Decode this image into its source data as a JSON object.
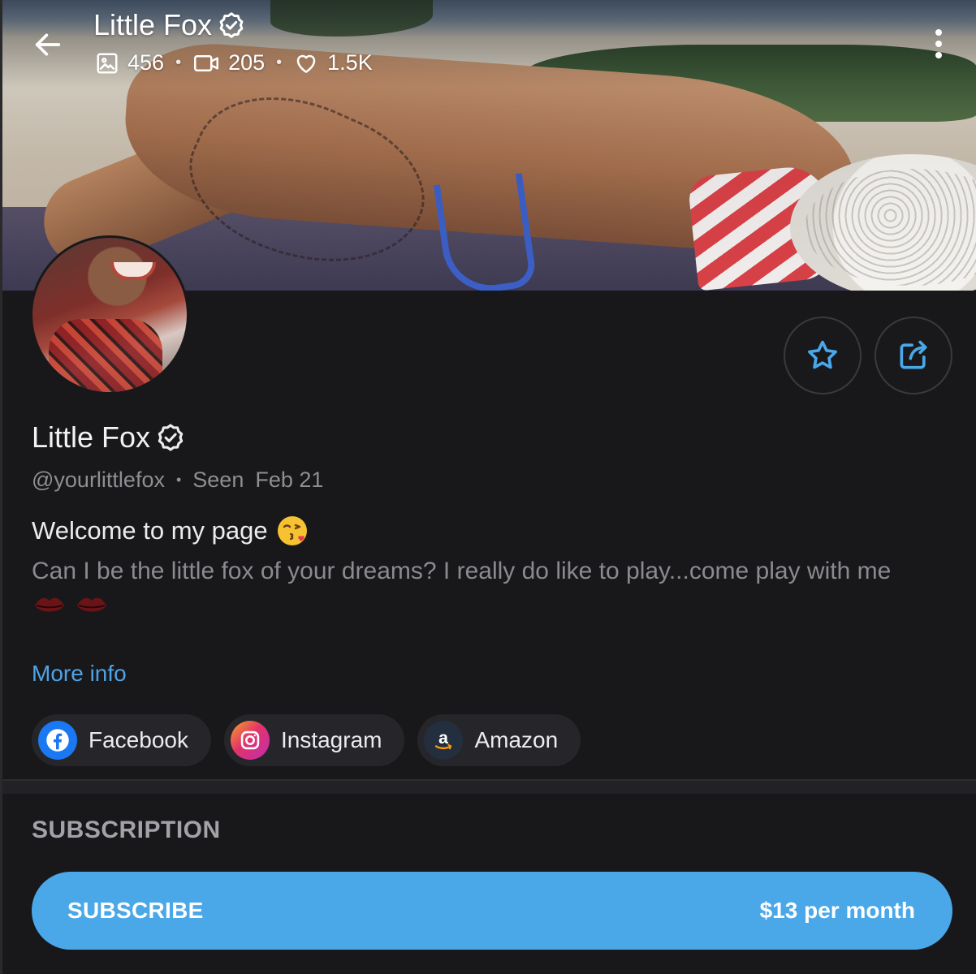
{
  "header": {
    "title": "Little Fox",
    "stats": [
      {
        "icon": "image-icon",
        "value": "456"
      },
      {
        "icon": "video-icon",
        "value": "205"
      },
      {
        "icon": "heart-icon",
        "value": "1.5K"
      }
    ]
  },
  "profile": {
    "name": "Little Fox",
    "handle": "@yourlittlefox",
    "seen_label": "Seen",
    "seen_date": "Feb 21",
    "bio_line1": "Welcome to my page",
    "bio_line1_emoji": "kiss-face-emoji",
    "bio_line2": "Can I be the little fox of your dreams? I really do like to play...come play with me",
    "bio_emojis": [
      "lips-emoji",
      "lips-emoji"
    ],
    "more_info": "More info"
  },
  "social_links": [
    {
      "label": "Facebook",
      "icon": "facebook-icon"
    },
    {
      "label": "Instagram",
      "icon": "instagram-icon"
    },
    {
      "label": "Amazon",
      "icon": "amazon-icon"
    }
  ],
  "subscription": {
    "section_title": "SUBSCRIPTION",
    "button_label": "SUBSCRIBE",
    "price": "$13 per month"
  },
  "colors": {
    "accent": "#4aa8e8",
    "link": "#4ea3e6",
    "background": "#18181b"
  }
}
